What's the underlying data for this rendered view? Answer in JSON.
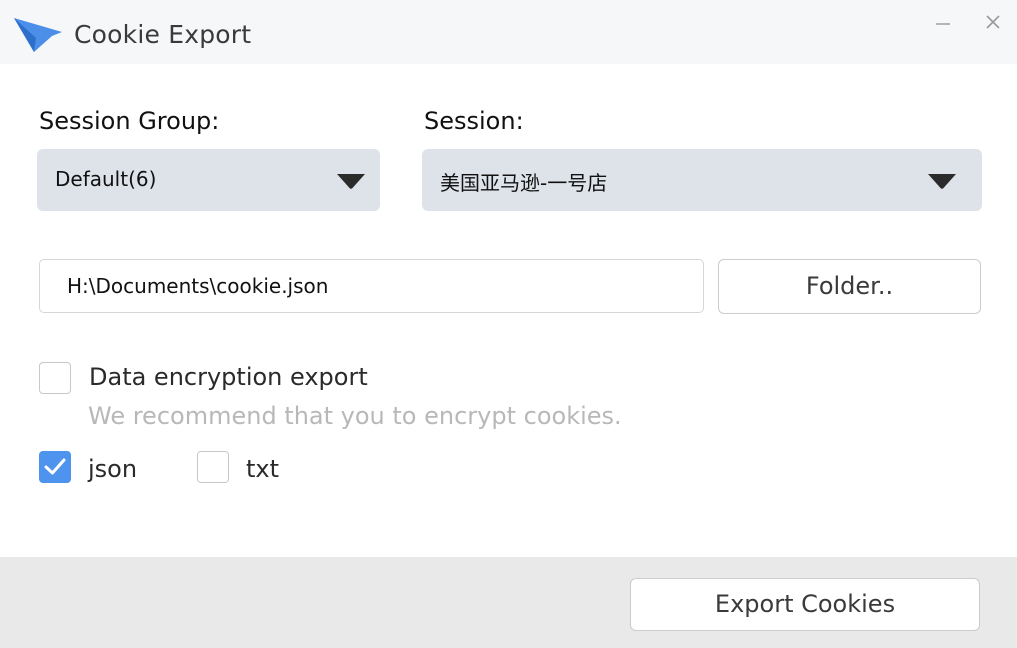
{
  "window": {
    "title": "Cookie Export",
    "accent_color": "#4e93ee",
    "logo_color": "#4b8fe8"
  },
  "session_group": {
    "label": "Session Group:",
    "selected": "Default(6)"
  },
  "session": {
    "label": "Session:",
    "selected": "美国亚马逊-一号店"
  },
  "export_path": {
    "value": "H:\\Documents\\cookie.json"
  },
  "folder_button": {
    "label": "Folder.."
  },
  "encryption": {
    "label": "Data encryption export",
    "checked": false,
    "hint": "We recommend that you to encrypt cookies."
  },
  "formats": [
    {
      "label": "json",
      "checked": true
    },
    {
      "label": "txt",
      "checked": false
    }
  ],
  "export_button": {
    "label": "Export Cookies"
  }
}
